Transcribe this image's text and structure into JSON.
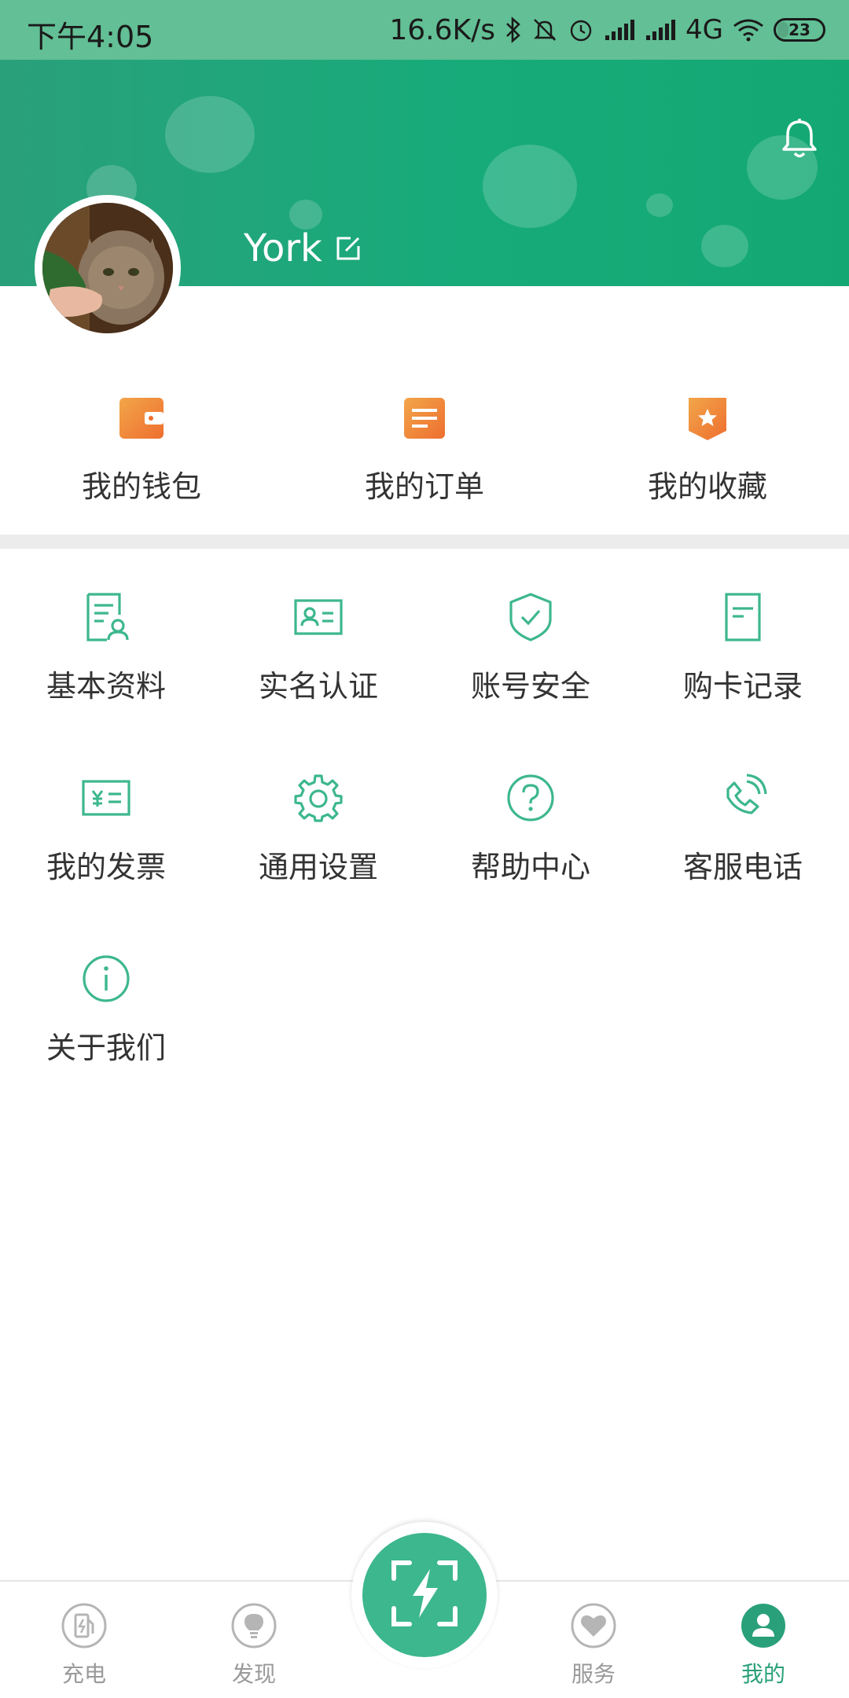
{
  "status_bar": {
    "time": "下午4:05",
    "net_speed": "16.6K/s",
    "network_type": "4G",
    "battery_level": "23",
    "icons": [
      "bluetooth-icon",
      "mute-icon",
      "alarm-icon",
      "signal-icon",
      "signal-icon",
      "wifi-icon",
      "battery-icon"
    ]
  },
  "profile": {
    "username": "York",
    "icons": [
      "bell-icon",
      "edit-icon",
      "avatar-image"
    ]
  },
  "quick_actions": [
    {
      "label": "我的钱包",
      "icon": "wallet-icon"
    },
    {
      "label": "我的订单",
      "icon": "order-icon"
    },
    {
      "label": "我的收藏",
      "icon": "favorite-icon"
    }
  ],
  "menu": [
    {
      "label": "基本资料",
      "icon": "profile-document-icon"
    },
    {
      "label": "实名认证",
      "icon": "id-card-icon"
    },
    {
      "label": "账号安全",
      "icon": "shield-check-icon"
    },
    {
      "label": "购卡记录",
      "icon": "card-record-icon"
    },
    {
      "label": "我的发票",
      "icon": "invoice-icon"
    },
    {
      "label": "通用设置",
      "icon": "gear-icon"
    },
    {
      "label": "帮助中心",
      "icon": "help-icon"
    },
    {
      "label": "客服电话",
      "icon": "phone-icon"
    },
    {
      "label": "关于我们",
      "icon": "info-icon"
    }
  ],
  "bottom_nav": [
    {
      "label": "充电",
      "icon": "charging-station-icon",
      "active": false
    },
    {
      "label": "发现",
      "icon": "lightbulb-icon",
      "active": false
    },
    {
      "label": "服务",
      "icon": "heart-icon",
      "active": false
    },
    {
      "label": "我的",
      "icon": "user-icon",
      "active": true
    }
  ],
  "scan_button": {
    "icon": "scan-charge-icon"
  },
  "colors": {
    "brand_green": "#2aa07a",
    "status_bar": "#63bf95",
    "icon_green": "#3db78d",
    "icon_orange": "#f08a3c",
    "inactive_gray": "#9a9a9a"
  }
}
